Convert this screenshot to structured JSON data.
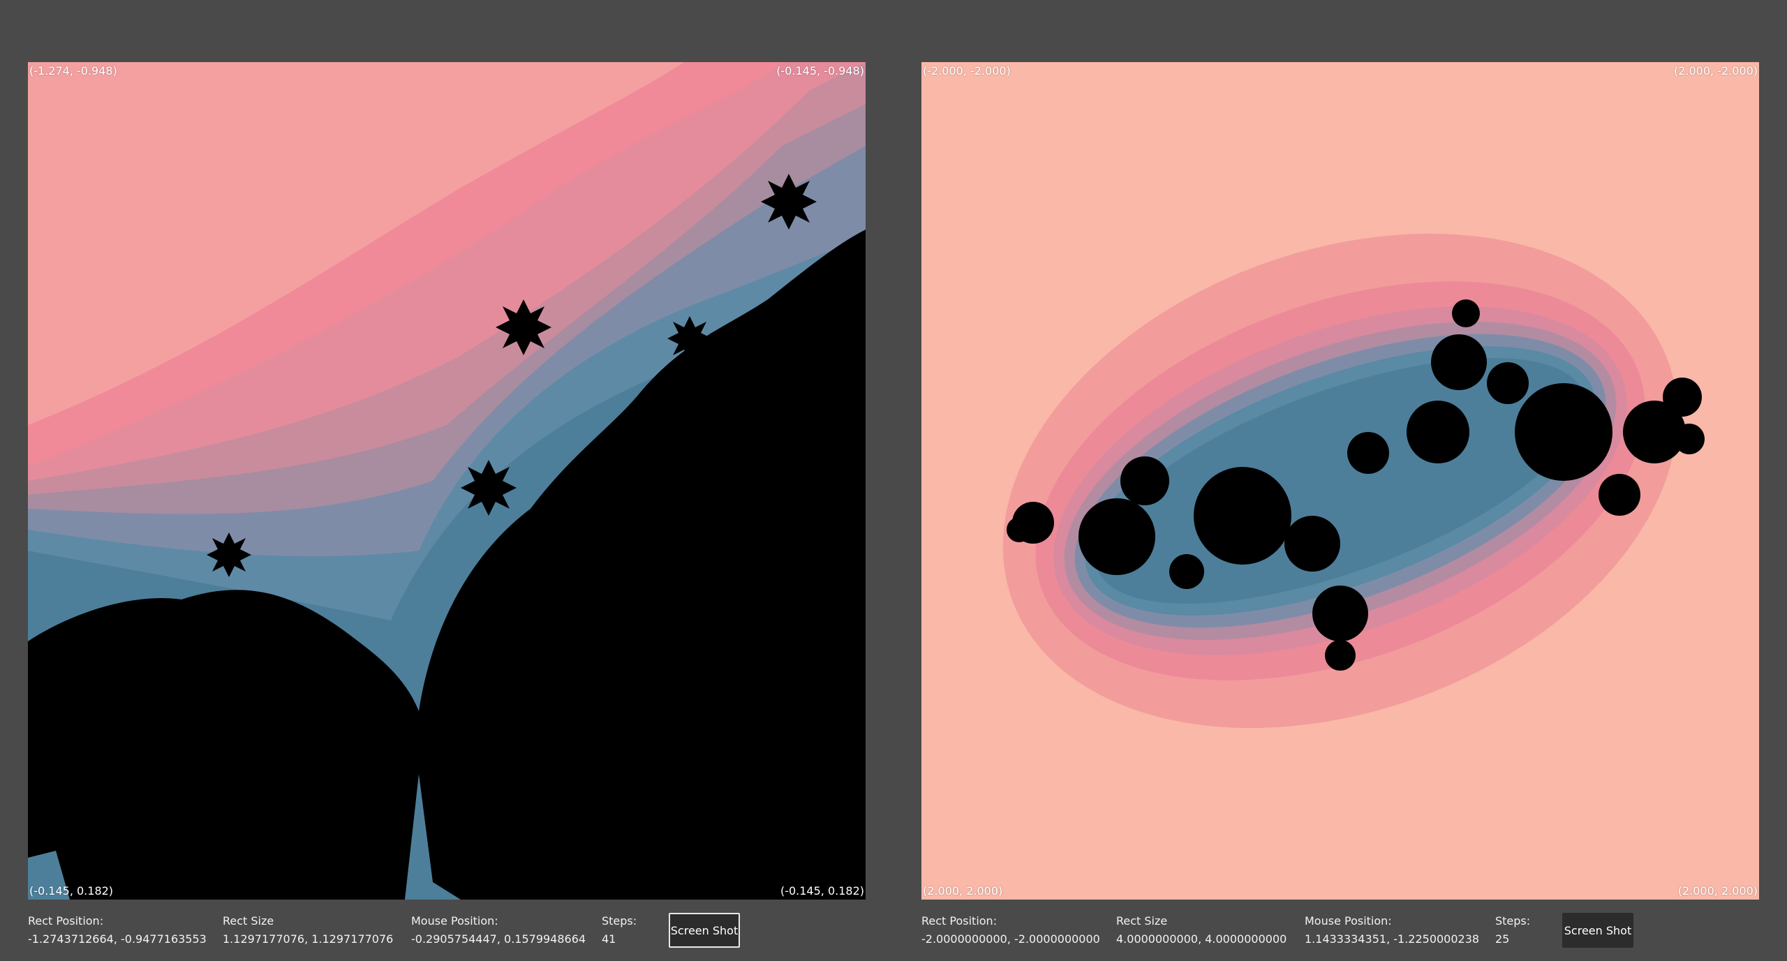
{
  "panels": [
    {
      "corners": {
        "top_left": "(-1.274, -0.948)",
        "top_right": "(-0.145, -0.948)",
        "bottom_left": "(-0.145, 0.182)",
        "bottom_right": "(-0.145, 0.182)"
      },
      "rect_position": {
        "label": "Rect Position:",
        "value": "-1.2743712664, -0.9477163553"
      },
      "rect_size": {
        "label": "Rect Size",
        "value": "1.1297177076, 1.1297177076"
      },
      "mouse_position": {
        "label": "Mouse Position:",
        "value": "-0.2905754447, 0.1579948664"
      },
      "steps": {
        "label": "Steps:",
        "value": "41"
      },
      "screenshot_button": "Screen Shot"
    },
    {
      "corners": {
        "top_left": "(-2.000, -2.000)",
        "top_right": "(2.000, -2.000)",
        "bottom_left": "(2.000, 2.000)",
        "bottom_right": "(2.000, 2.000)"
      },
      "rect_position": {
        "label": "Rect Position:",
        "value": "-2.0000000000, -2.0000000000"
      },
      "rect_size": {
        "label": "Rect Size",
        "value": "4.0000000000, 4.0000000000"
      },
      "mouse_position": {
        "label": "Mouse Position:",
        "value": "1.1433334351, -1.2250000238"
      },
      "steps": {
        "label": "Steps:",
        "value": "25"
      },
      "screenshot_button": "Screen Shot"
    }
  ],
  "colors": {
    "background": "#4a4a4a",
    "fractal_interior": "#000000",
    "palette_outer": "#f9b8a8",
    "palette_pink": "#f28d96",
    "palette_mauve": "#c48a9a",
    "palette_blue": "#5a8aa4",
    "button_bg": "#2c2c2c"
  }
}
